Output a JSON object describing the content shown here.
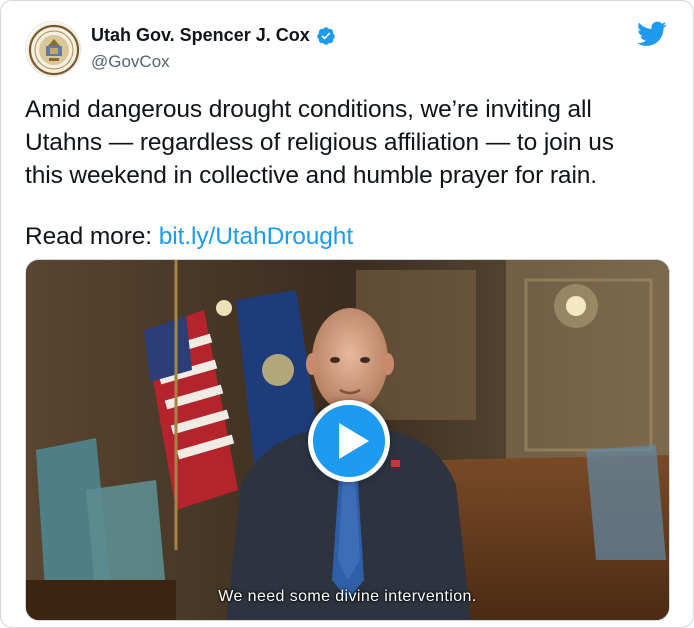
{
  "author": {
    "display_name": "Utah Gov. Spencer J. Cox",
    "handle": "@GovCox",
    "avatar_icon": "utah-state-seal",
    "verified_icon": "verified-badge-icon"
  },
  "platform_icon": "twitter-bird-icon",
  "tweet": {
    "lines": [
      "Amid dangerous drought conditions, we’re inviting all",
      "Utahns — regardless of religious affiliation — to join us",
      "this weekend in collective and humble prayer for rain."
    ],
    "read_more_label": "Read more:",
    "link_text": "bit.ly/UtahDrought"
  },
  "video": {
    "caption": "We need some divine intervention.",
    "play_icon": "play-icon"
  },
  "colors": {
    "accent": "#1d9bf0",
    "text": "#0f1419",
    "secondary_text": "#536471"
  }
}
